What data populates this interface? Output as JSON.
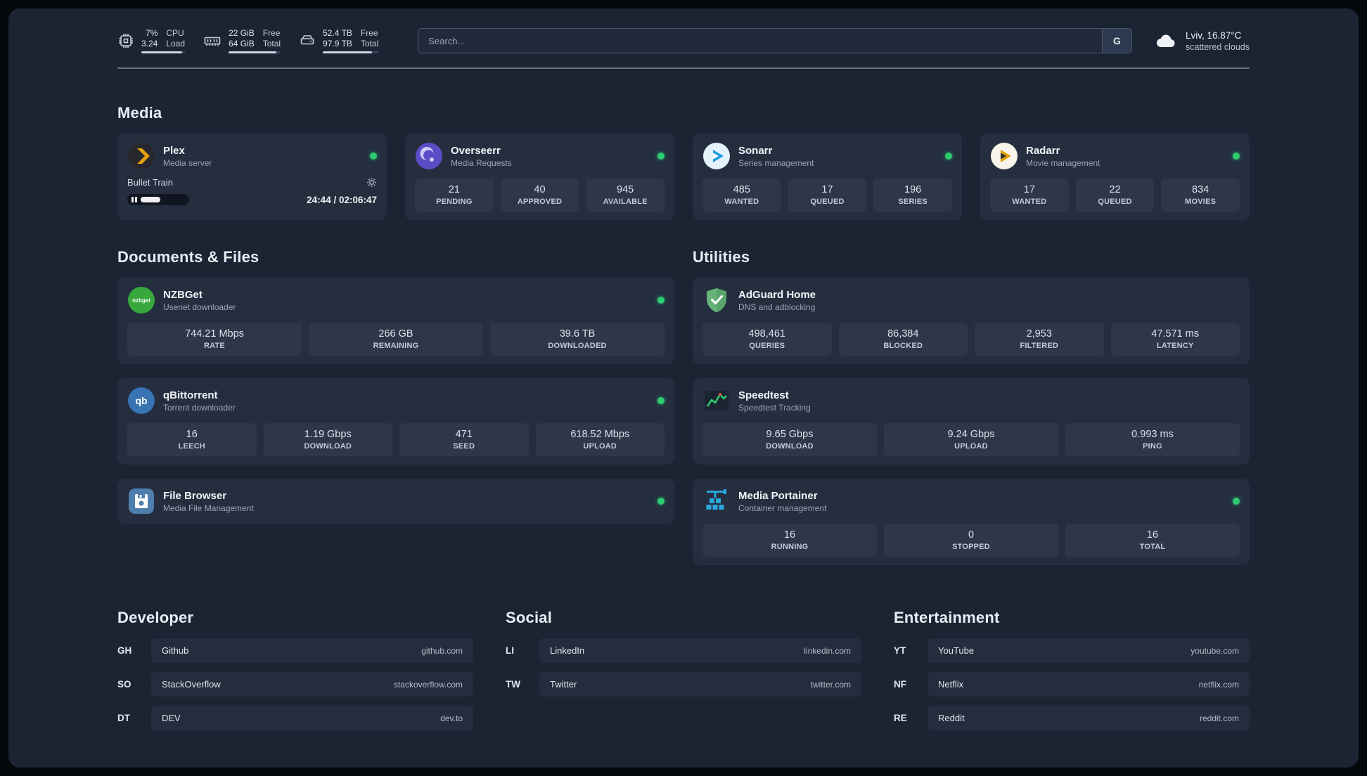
{
  "topbar": {
    "cpu": {
      "v1": "7%",
      "v2": "3.24",
      "l1": "CPU",
      "l2": "Load"
    },
    "ram": {
      "v1": "22 GiB",
      "v2": "64 GiB",
      "l1": "Free",
      "l2": "Total"
    },
    "disk": {
      "v1": "52.4 TB",
      "v2": "97.9 TB",
      "l1": "Free",
      "l2": "Total"
    },
    "search": {
      "placeholder": "Search...",
      "engine": "G"
    },
    "weather": {
      "line1": "Lviv, 16.87°C",
      "line2": "scattered clouds"
    }
  },
  "media": {
    "title": "Media",
    "plex": {
      "name": "Plex",
      "subtitle": "Media server",
      "track": "Bullet Train",
      "time": "24:44 / 02:06:47"
    },
    "overseerr": {
      "name": "Overseerr",
      "subtitle": "Media Requests",
      "stats": [
        {
          "v": "21",
          "l": "PENDING"
        },
        {
          "v": "40",
          "l": "APPROVED"
        },
        {
          "v": "945",
          "l": "AVAILABLE"
        }
      ]
    },
    "sonarr": {
      "name": "Sonarr",
      "subtitle": "Series management",
      "stats": [
        {
          "v": "485",
          "l": "WANTED"
        },
        {
          "v": "17",
          "l": "QUEUED"
        },
        {
          "v": "196",
          "l": "SERIES"
        }
      ]
    },
    "radarr": {
      "name": "Radarr",
      "subtitle": "Movie management",
      "stats": [
        {
          "v": "17",
          "l": "WANTED"
        },
        {
          "v": "22",
          "l": "QUEUED"
        },
        {
          "v": "834",
          "l": "MOVIES"
        }
      ]
    }
  },
  "documents": {
    "title": "Documents & Files",
    "nzbget": {
      "name": "NZBGet",
      "subtitle": "Usenet downloader",
      "icon_text": "nzbget",
      "stats": [
        {
          "v": "744.21 Mbps",
          "l": "RATE"
        },
        {
          "v": "266 GB",
          "l": "REMAINING"
        },
        {
          "v": "39.6 TB",
          "l": "DOWNLOADED"
        }
      ]
    },
    "qbittorrent": {
      "name": "qBittorrent",
      "subtitle": "Torrent downloader",
      "icon_text": "qb",
      "stats": [
        {
          "v": "16",
          "l": "LEECH"
        },
        {
          "v": "1.19 Gbps",
          "l": "DOWNLOAD"
        },
        {
          "v": "471",
          "l": "SEED"
        },
        {
          "v": "618.52 Mbps",
          "l": "UPLOAD"
        }
      ]
    },
    "filebrowser": {
      "name": "File Browser",
      "subtitle": "Media File Management"
    }
  },
  "utilities": {
    "title": "Utilities",
    "adguard": {
      "name": "AdGuard Home",
      "subtitle": "DNS and adblocking",
      "stats": [
        {
          "v": "498,461",
          "l": "QUERIES"
        },
        {
          "v": "86,384",
          "l": "BLOCKED"
        },
        {
          "v": "2,953",
          "l": "FILTERED"
        },
        {
          "v": "47.571 ms",
          "l": "LATENCY"
        }
      ]
    },
    "speedtest": {
      "name": "Speedtest",
      "subtitle": "Speedtest Tracking",
      "stats": [
        {
          "v": "9.65 Gbps",
          "l": "DOWNLOAD"
        },
        {
          "v": "9.24 Gbps",
          "l": "UPLOAD"
        },
        {
          "v": "0.993 ms",
          "l": "PING"
        }
      ]
    },
    "portainer": {
      "name": "Media Portainer",
      "subtitle": "Container management",
      "stats": [
        {
          "v": "16",
          "l": "RUNNING"
        },
        {
          "v": "0",
          "l": "STOPPED"
        },
        {
          "v": "16",
          "l": "TOTAL"
        }
      ]
    }
  },
  "bookmarks": {
    "developer": {
      "title": "Developer",
      "items": [
        {
          "abbr": "GH",
          "name": "Github",
          "url": "github.com"
        },
        {
          "abbr": "SO",
          "name": "StackOverflow",
          "url": "stackoverflow.com"
        },
        {
          "abbr": "DT",
          "name": "DEV",
          "url": "dev.to"
        }
      ]
    },
    "social": {
      "title": "Social",
      "items": [
        {
          "abbr": "LI",
          "name": "LinkedIn",
          "url": "linkedin.com"
        },
        {
          "abbr": "TW",
          "name": "Twitter",
          "url": "twitter.com"
        }
      ]
    },
    "entertainment": {
      "title": "Entertainment",
      "items": [
        {
          "abbr": "YT",
          "name": "YouTube",
          "url": "youtube.com"
        },
        {
          "abbr": "NF",
          "name": "Netflix",
          "url": "netflix.com"
        },
        {
          "abbr": "RE",
          "name": "Reddit",
          "url": "reddit.com"
        }
      ]
    }
  },
  "colors": {
    "online": "#2ecc71",
    "accent": "#e5a00d"
  }
}
